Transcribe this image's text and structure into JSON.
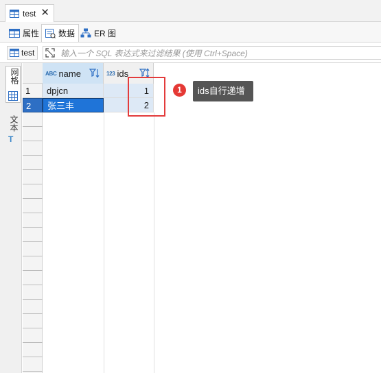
{
  "editor_tab": {
    "label": "test",
    "close_glyph": "✕"
  },
  "subtabs": [
    {
      "label": "属性",
      "icon": "table-icon"
    },
    {
      "label": "数据",
      "icon": "data-icon"
    },
    {
      "label": "ER 图",
      "icon": "er-diagram-icon"
    }
  ],
  "filter": {
    "source_label": "test",
    "placeholder": "输入一个 SQL 表达式来过滤结果 (使用 Ctrl+Space)"
  },
  "side_panel": {
    "grid_label": "网格",
    "text_label": "文本",
    "text_icon": "T"
  },
  "grid": {
    "columns": [
      {
        "name": "name",
        "type_badge": "ABC"
      },
      {
        "name": "ids",
        "type_badge": "123"
      }
    ],
    "rows": [
      {
        "num": "1",
        "name": "dpjcn",
        "ids": "1"
      },
      {
        "num": "2",
        "name": "张三丰",
        "ids": "2"
      }
    ]
  },
  "annotation": {
    "badge": "1",
    "text": "ids自行递增"
  },
  "colors": {
    "accent": "#1f74d8",
    "annotation_red": "#e53935",
    "tooltip_bg": "#555555"
  }
}
